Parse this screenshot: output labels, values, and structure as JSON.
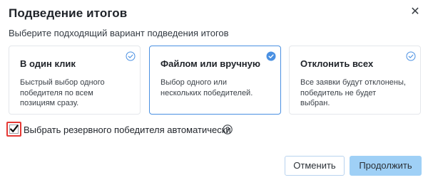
{
  "dialog": {
    "title": "Подведение итогов",
    "subtitle": "Выберите подходящий вариант подведения итогов",
    "close_icon": "close-icon"
  },
  "options": [
    {
      "title": "В один клик",
      "description": "Быстрый выбор одного победителя по всем позициям сразу.",
      "selected": false
    },
    {
      "title": "Файлом или вручную",
      "description": "Выбор одного или нескольких победителей.",
      "selected": true
    },
    {
      "title": "Отклонить всех",
      "description": "Все заявки будут отклонены, победитель не будет выбран.",
      "selected": false
    }
  ],
  "reserve": {
    "label": "Выбрать резервного победителя автоматически",
    "checked": true,
    "help_icon": "question-circle-icon"
  },
  "buttons": {
    "cancel": "Отменить",
    "continue": "Продолжить"
  },
  "colors": {
    "accent": "#4a90e2",
    "primary_button": "#9fd0f6",
    "highlight_border": "#e53935"
  }
}
